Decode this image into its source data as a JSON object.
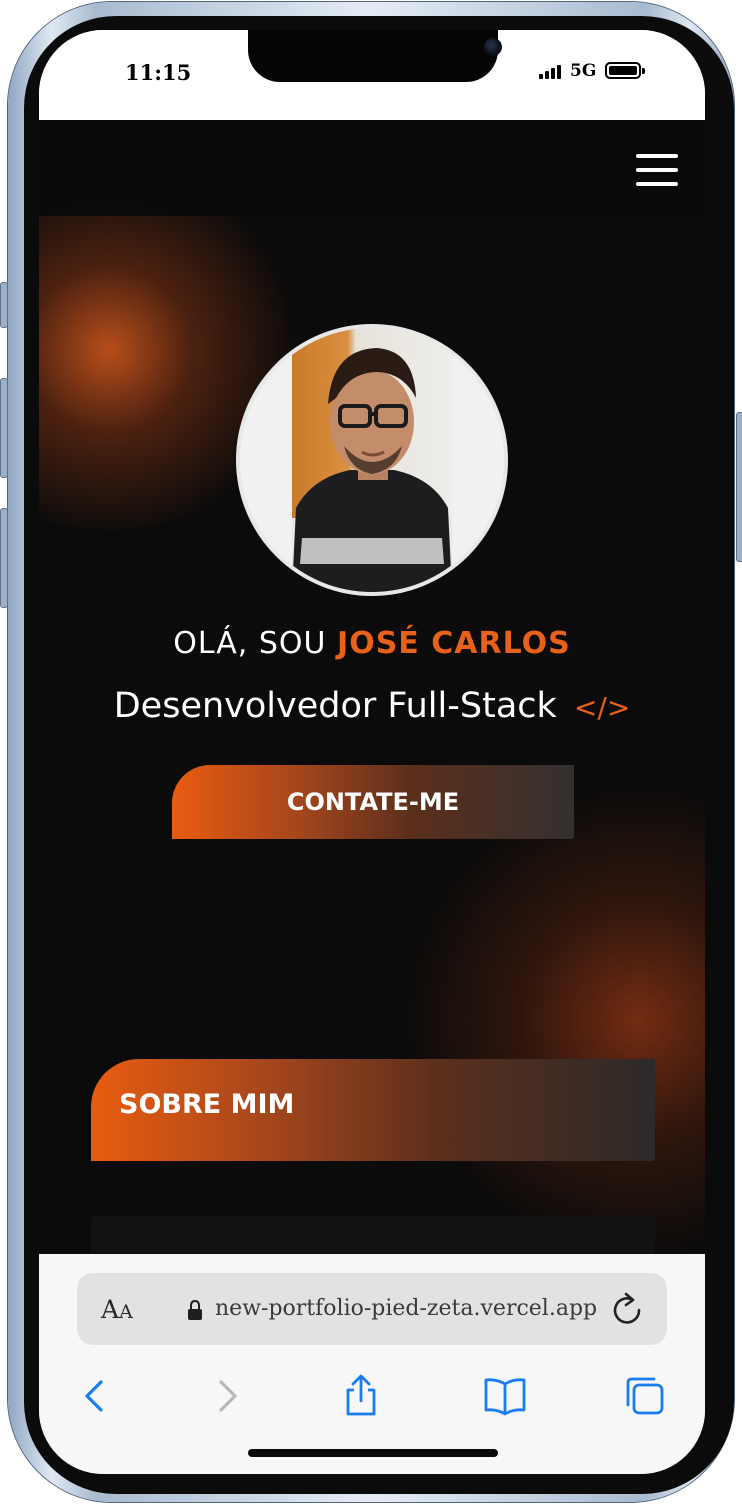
{
  "status_bar": {
    "time": "11:15",
    "network": "5G",
    "signal_icon": "cellular-signal-icon",
    "battery_icon": "battery-full-icon"
  },
  "site": {
    "menu_icon": "hamburger-menu-icon",
    "accent_color": "#e8611a",
    "greeting_prefix": "OLÁ, SOU",
    "name": "JOSÉ CARLOS",
    "role": "Desenvolvedor Full-Stack",
    "role_icon": "</>",
    "contact_button": "CONTATE-ME",
    "about_title": "SOBRE MIM"
  },
  "browser": {
    "text_size_label": "AA",
    "lock_icon": "lock-icon",
    "url": "new-portfolio-pied-zeta.vercel.app",
    "reload_icon": "reload-icon",
    "toolbar_icons": [
      "back-icon",
      "forward-icon",
      "share-icon",
      "bookmarks-icon",
      "tabs-icon"
    ]
  }
}
